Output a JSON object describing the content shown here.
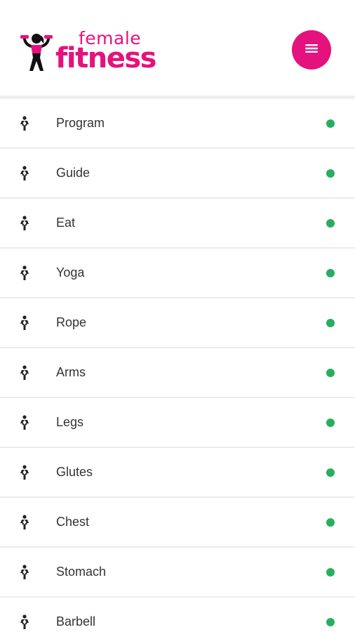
{
  "brand": {
    "name_top": "female",
    "name_bottom": "fitness",
    "logo_icon": "woman-dumbbells-icon",
    "accent_color": "#e5127d"
  },
  "header": {
    "menu_icon": "hamburger-menu-icon"
  },
  "menu": {
    "item_icon": "woman-figure-icon",
    "status_color": "#27ae60",
    "items": [
      {
        "label": "Program"
      },
      {
        "label": "Guide"
      },
      {
        "label": "Eat"
      },
      {
        "label": "Yoga"
      },
      {
        "label": "Rope"
      },
      {
        "label": "Arms"
      },
      {
        "label": "Legs"
      },
      {
        "label": "Glutes"
      },
      {
        "label": "Chest"
      },
      {
        "label": "Stomach"
      },
      {
        "label": "Barbell"
      }
    ]
  }
}
